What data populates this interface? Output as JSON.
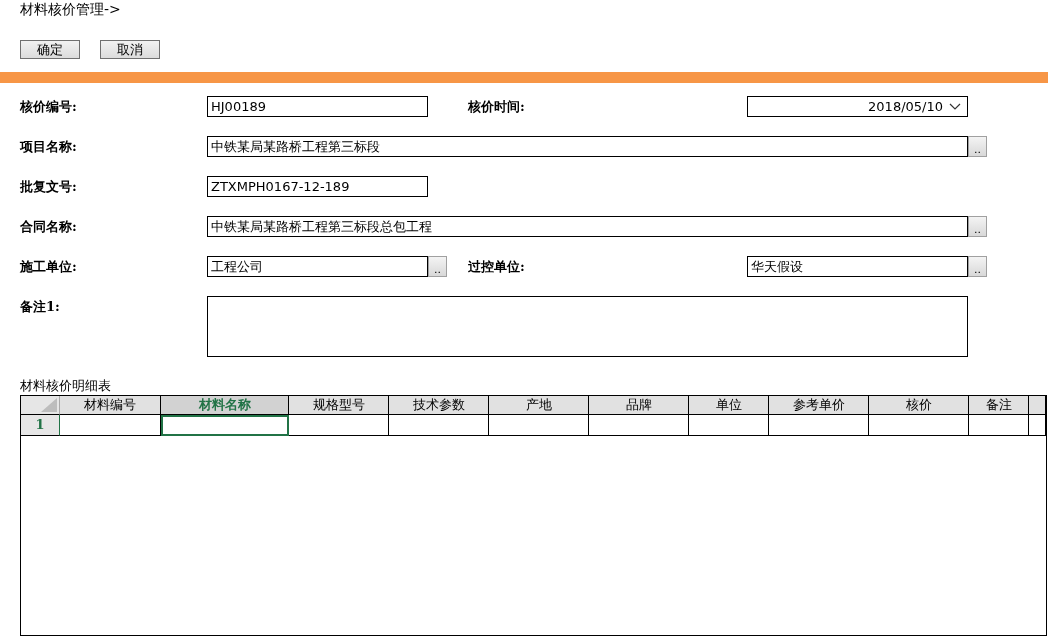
{
  "page_title": "材料核价管理->",
  "buttons": [
    "确定",
    "取消"
  ],
  "form": {
    "rows": [
      {
        "fields": [
          {
            "label": "核价编号:",
            "kind": "short",
            "value": "HJ00189"
          },
          {
            "label": "核价时间:",
            "kind": "date",
            "value": "2018/05/10"
          }
        ]
      },
      {
        "fields": [
          {
            "label": "项目名称:",
            "kind": "long",
            "value": "中铁某局某路桥工程第三标段",
            "button": ".."
          }
        ]
      },
      {
        "fields": [
          {
            "label": "批复文号:",
            "kind": "short",
            "value": "ZTXMPH0167-12-189"
          }
        ]
      },
      {
        "fields": [
          {
            "label": "合同名称:",
            "kind": "long",
            "value": "中铁某局某路桥工程第三标段总包工程",
            "button": ".."
          }
        ]
      },
      {
        "fields": [
          {
            "label": "施工单位:",
            "kind": "short",
            "value": "工程公司",
            "button": ".."
          },
          {
            "label": "过控单位:",
            "kind": "short",
            "value": "华天假设",
            "button": ".."
          }
        ]
      },
      {
        "fields": [
          {
            "label": "备注1:",
            "kind": "textarea"
          }
        ]
      }
    ]
  },
  "table": {
    "caption": "材料核价明细表",
    "columns": [
      {
        "label": "材料编号",
        "selected": false
      },
      {
        "label": "材料名称",
        "selected": true
      },
      {
        "label": "规格型号",
        "selected": false
      },
      {
        "label": "技术参数",
        "selected": false
      },
      {
        "label": "产地",
        "selected": false
      },
      {
        "label": "品牌",
        "selected": false
      },
      {
        "label": "单位",
        "selected": false
      },
      {
        "label": "参考单价",
        "selected": false
      },
      {
        "label": "核价",
        "selected": false
      },
      {
        "label": "备注",
        "selected": false
      }
    ],
    "rows": [
      {
        "number": "1",
        "selected": true
      }
    ]
  }
}
